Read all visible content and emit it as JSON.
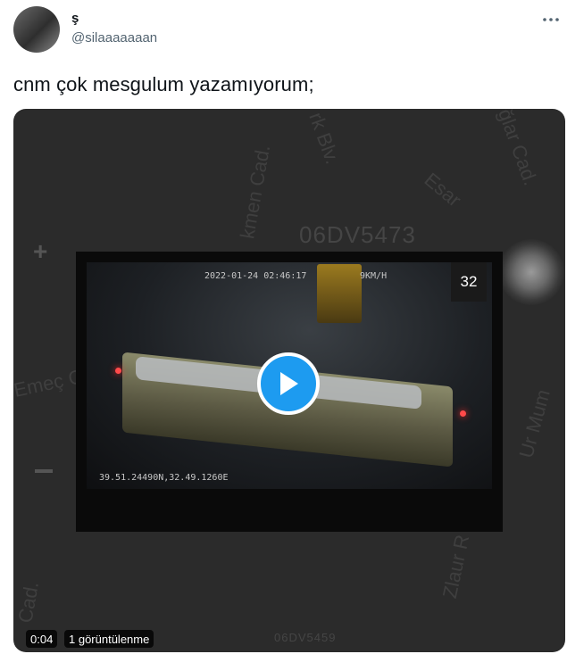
{
  "tweet": {
    "display_name": "ş",
    "handle": "@silaaaaaaan",
    "text": "cnm çok mesgulum yazamıyorum;"
  },
  "media": {
    "map_labels": {
      "street_1": "Emeç C",
      "street_2": "rk Blv.",
      "street_3": "kmen Cad.",
      "street_4": "Esar",
      "street_5": "ğlar Cad.",
      "street_6": "Zlaur R",
      "street_7": "Ur Mum",
      "plate_top": "06DV5473",
      "plate_bottom": "06DV5459",
      "map_corner": "Cad."
    },
    "dashcam": {
      "timestamp": "2022-01-24 02:46:17",
      "speed": "9KM/H",
      "gps": "39.51.24490N,32.49.1260E"
    },
    "speed_badge": "32",
    "video_time": "0:04",
    "view_count": "1 görüntülenme"
  },
  "icons": {
    "more": "more-horizontal-icon",
    "play": "play-icon"
  },
  "colors": {
    "accent": "#1d9bf0",
    "text": "#0f1419",
    "secondary_text": "#536471"
  }
}
